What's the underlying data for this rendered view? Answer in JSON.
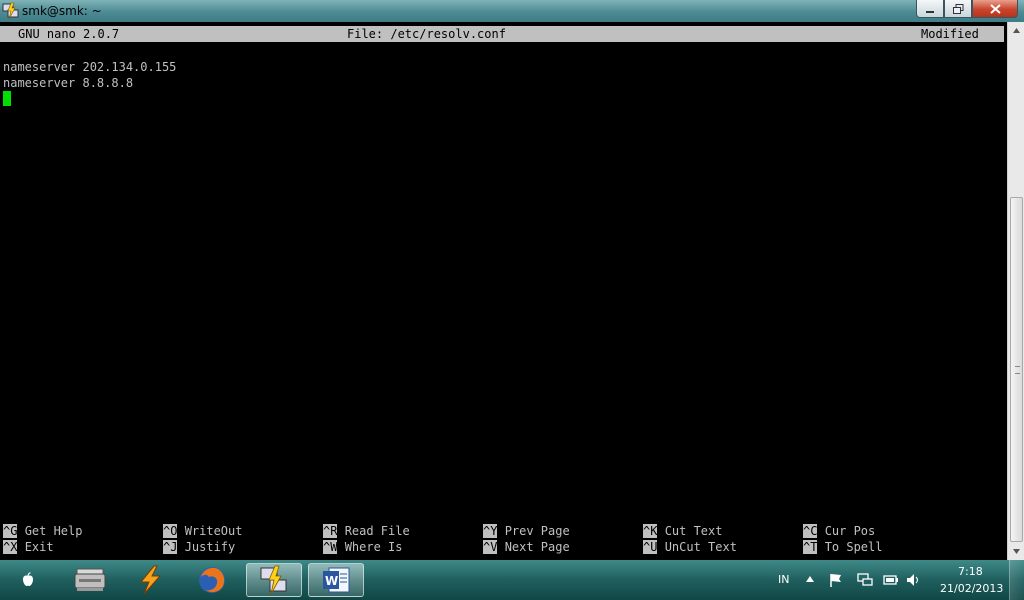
{
  "window": {
    "title": "smk@smk: ~",
    "minimize_icon": "minimize-icon",
    "maximize_icon": "restore-icon",
    "close_icon": "close-icon"
  },
  "nano": {
    "version": "GNU nano 2.0.7",
    "file": "File: /etc/resolv.conf",
    "status": "Modified",
    "lines": [
      "nameserver 202.134.0.155",
      "nameserver 8.8.8.8"
    ],
    "shortcuts": [
      {
        "key": "^G",
        "label": "Get Help"
      },
      {
        "key": "^O",
        "label": "WriteOut"
      },
      {
        "key": "^R",
        "label": "Read File"
      },
      {
        "key": "^Y",
        "label": "Prev Page"
      },
      {
        "key": "^K",
        "label": "Cut Text"
      },
      {
        "key": "^C",
        "label": "Cur Pos"
      },
      {
        "key": "^X",
        "label": "Exit"
      },
      {
        "key": "^J",
        "label": "Justify"
      },
      {
        "key": "^W",
        "label": "Where Is"
      },
      {
        "key": "^V",
        "label": "Next Page"
      },
      {
        "key": "^U",
        "label": "UnCut Text"
      },
      {
        "key": "^T",
        "label": "To Spell"
      }
    ]
  },
  "taskbar": {
    "apps": [
      "apple-icon",
      "scanner-icon",
      "winamp-icon",
      "firefox-icon",
      "putty-icon",
      "word-icon"
    ],
    "language": "IN",
    "time": "7:18",
    "date": "21/02/2013"
  },
  "colors": {
    "cursor": "#00e000",
    "header_bg": "#c0c0c0",
    "terminal_bg": "#000000"
  }
}
